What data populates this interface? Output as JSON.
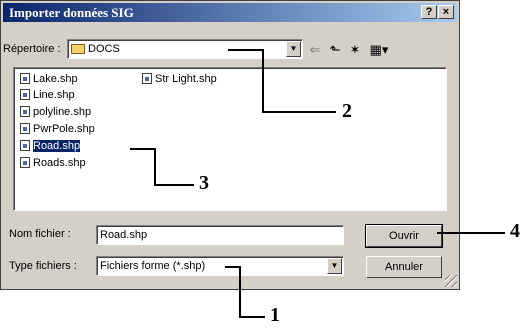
{
  "window": {
    "title": "Importer données SIG",
    "help_label": "?",
    "close_label": "×"
  },
  "toolbar": {
    "directory_label": "Répertoire :",
    "directory_value": "DOCS",
    "icons": [
      "back-arrow-icon",
      "up-folder-icon",
      "new-folder-icon",
      "view-menu-icon"
    ],
    "back_glyph": "⇐",
    "up_glyph": "⬑",
    "new_glyph": "✶",
    "view_glyph": "▦▾"
  },
  "files": {
    "col1": [
      "Lake.shp",
      "Line.shp",
      "polyline.shp",
      "PwrPole.shp",
      "Road.shp",
      "Roads.shp"
    ],
    "col2": [
      "Str Light.shp"
    ],
    "selected": "Road.shp"
  },
  "form": {
    "filename_label": "Nom fichier :",
    "filename_value": "Road.shp",
    "filetype_label": "Type fichiers :",
    "filetype_value": "Fichiers forme (*.shp)"
  },
  "buttons": {
    "open_label": "Ouvrir",
    "cancel_label": "Annuler"
  },
  "callouts": {
    "c1": "1",
    "c2": "2",
    "c3": "3",
    "c4": "4"
  }
}
